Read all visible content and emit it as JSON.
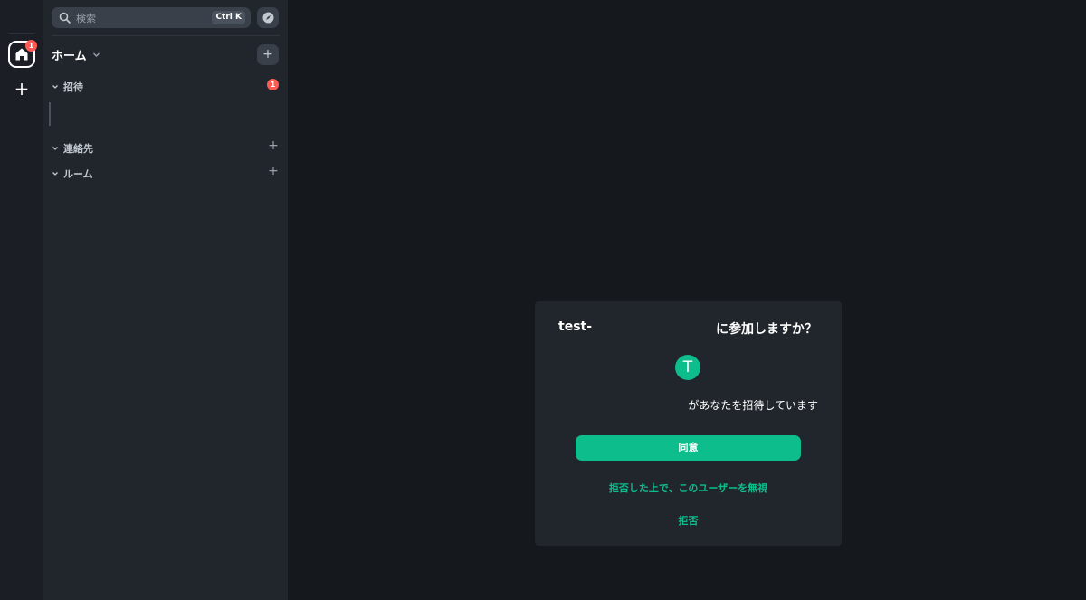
{
  "spacebar": {
    "home_badge": "1",
    "create_space_glyph": "+"
  },
  "roompanel": {
    "search": {
      "label": "検索",
      "shortcut": "Ctrl K"
    },
    "home": {
      "title": "ホーム",
      "add_glyph": "+"
    },
    "sections": {
      "invites": {
        "label": "招待",
        "badge": "1"
      },
      "contacts": {
        "label": "連絡先",
        "add_glyph": "+"
      },
      "rooms": {
        "label": "ルーム",
        "add_glyph": "+"
      }
    }
  },
  "invite": {
    "room_name": "test-",
    "question": "に参加しますか？",
    "avatar_letter": "T",
    "inviter_text": "があなたを招待しています",
    "accept_label": "同意",
    "reject_ignore_label": "拒否した上で、このユーザーを無視",
    "reject_label": "拒否"
  },
  "colors": {
    "accent": "#0dbd8b",
    "badge": "#ff5b55",
    "background": "#15191e",
    "panel": "#21262c"
  }
}
